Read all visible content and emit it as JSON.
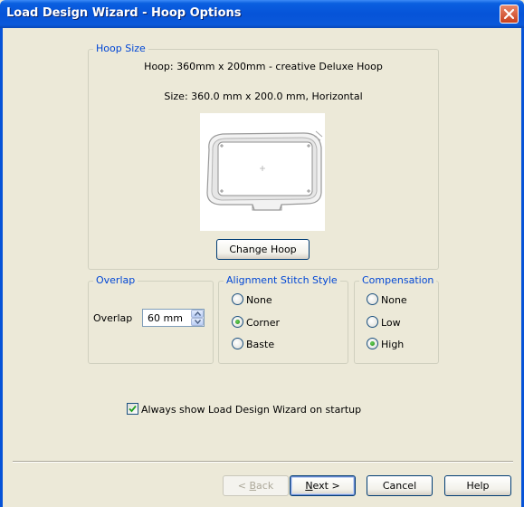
{
  "window": {
    "title": "Load Design Wizard - Hoop Options"
  },
  "hoop_size": {
    "legend": "Hoop Size",
    "hoop_line": "Hoop: 360mm x 200mm - creative Deluxe Hoop",
    "size_line": "Size: 360.0 mm x 200.0 mm, Horizontal",
    "change_button": "Change Hoop"
  },
  "overlap": {
    "legend": "Overlap",
    "label": "Overlap",
    "value": "60 mm"
  },
  "alignment": {
    "legend": "Alignment Stitch Style",
    "options": [
      "None",
      "Corner",
      "Baste"
    ],
    "selected": "Corner"
  },
  "compensation": {
    "legend": "Compensation",
    "options": [
      "None",
      "Low",
      "High"
    ],
    "selected": "High"
  },
  "startup_checkbox": {
    "label": "Always show Load Design Wizard on startup",
    "checked": true
  },
  "footer": {
    "back_prefix": "< ",
    "back_key": "B",
    "back_rest": "ack",
    "next_key": "N",
    "next_rest": "ext >",
    "cancel": "Cancel",
    "help": "Help"
  },
  "colors": {
    "accent": "#0046D5",
    "titlebar": "#0653D8",
    "background": "#ECE9D8"
  },
  "icons": [
    "close-icon",
    "hoop-preview",
    "spin-up-icon",
    "spin-down-icon",
    "check-icon"
  ]
}
